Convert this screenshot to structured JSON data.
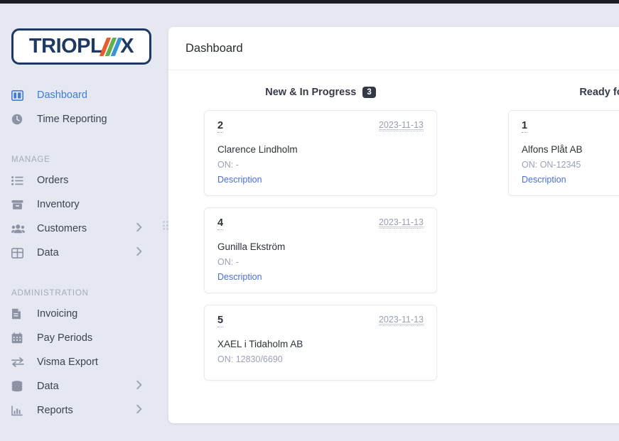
{
  "brand": {
    "name_part1": "TRIOPL",
    "name_part2": "X",
    "bar_colors": [
      "#ea5b2d",
      "#5fb14e",
      "#3a93d6"
    ],
    "border_color": "#1e3a63"
  },
  "sidebar": {
    "primary": [
      {
        "label": "Dashboard",
        "icon": "dashboard-columns-icon",
        "active": true,
        "chevron": false
      },
      {
        "label": "Time Reporting",
        "icon": "clock-icon",
        "active": false,
        "chevron": false
      }
    ],
    "sections": [
      {
        "title": "MANAGE",
        "items": [
          {
            "label": "Orders",
            "icon": "list-icon",
            "chevron": false
          },
          {
            "label": "Inventory",
            "icon": "box-icon",
            "chevron": false
          },
          {
            "label": "Customers",
            "icon": "users-icon",
            "chevron": true
          },
          {
            "label": "Data",
            "icon": "table-grid-icon",
            "chevron": true
          }
        ]
      },
      {
        "title": "ADMINISTRATION",
        "items": [
          {
            "label": "Invoicing",
            "icon": "invoice-icon",
            "chevron": false
          },
          {
            "label": "Pay Periods",
            "icon": "calendar-icon",
            "chevron": false
          },
          {
            "label": "Visma Export",
            "icon": "exchange-arrows-icon",
            "chevron": false
          },
          {
            "label": "Data",
            "icon": "database-icon",
            "chevron": true
          },
          {
            "label": "Reports",
            "icon": "bar-chart-icon",
            "chevron": true
          }
        ]
      }
    ]
  },
  "header": {
    "title": "Dashboard"
  },
  "board": {
    "columns": [
      {
        "label": "New & In Progress",
        "count": "3",
        "cards": [
          {
            "number": "2",
            "date": "2023-11-13",
            "customer": "Clarence Lindholm",
            "on": "ON: -",
            "link": "Description"
          },
          {
            "number": "4",
            "date": "2023-11-13",
            "customer": "Gunilla Ekström",
            "on": "ON: -",
            "link": "Description"
          },
          {
            "number": "5",
            "date": "2023-11-13",
            "customer": "XAEL i Tidaholm AB",
            "on": "ON: 12830/6690",
            "link": ""
          }
        ]
      },
      {
        "label": "Ready for Delivery",
        "count": "",
        "cards": [
          {
            "number": "1",
            "date": "",
            "customer": "Alfons Plåt AB",
            "on": "ON: ON-12345",
            "link": "Description"
          }
        ]
      }
    ]
  },
  "colors": {
    "page_background": "#e5e8f0",
    "panel_background": "#ffffff",
    "accent_link": "#4a6fd6",
    "active_nav": "#3d7dd8",
    "badge_background": "#333945",
    "topbar": "#1b1d24"
  }
}
